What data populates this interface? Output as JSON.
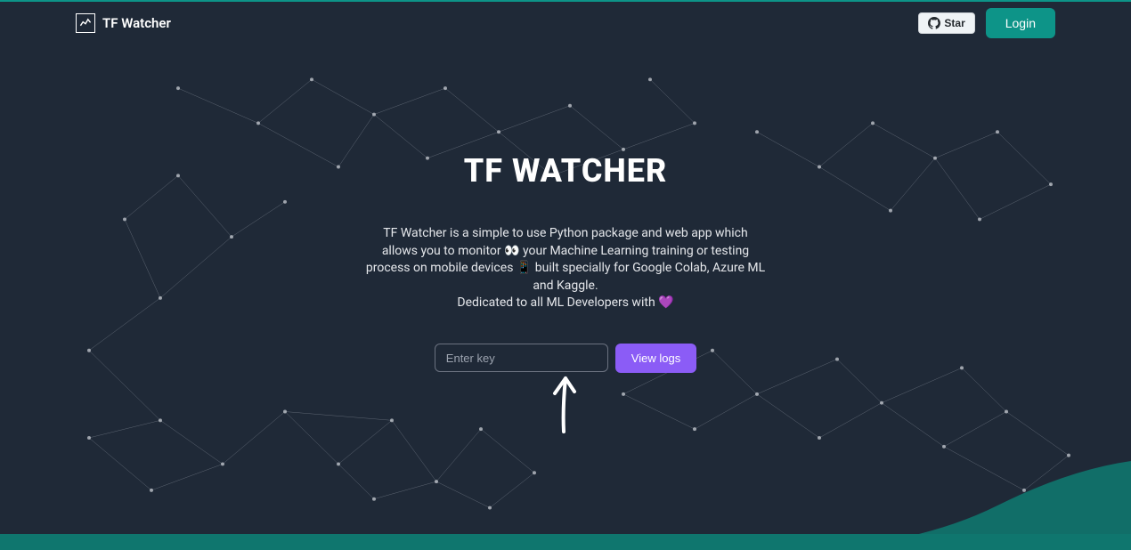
{
  "header": {
    "brand_name": "TF Watcher",
    "star_label": "Star",
    "login_label": "Login"
  },
  "hero": {
    "title": "TF WATCHER",
    "description_line1": "TF Watcher is a simple to use Python package and web app which allows you to",
    "description_line2": "monitor 👀 your Machine Learning training or testing process on mobile devices",
    "description_line3": "📱 built specially for Google Colab, Azure ML and Kaggle.",
    "description_line4": "Dedicated to all ML Developers with 💜",
    "input_placeholder": "Enter key",
    "view_logs_label": "View logs"
  },
  "colors": {
    "accent_teal": "#0d9488",
    "accent_purple": "#8b5cf6",
    "bg_dark": "#1f2937"
  }
}
